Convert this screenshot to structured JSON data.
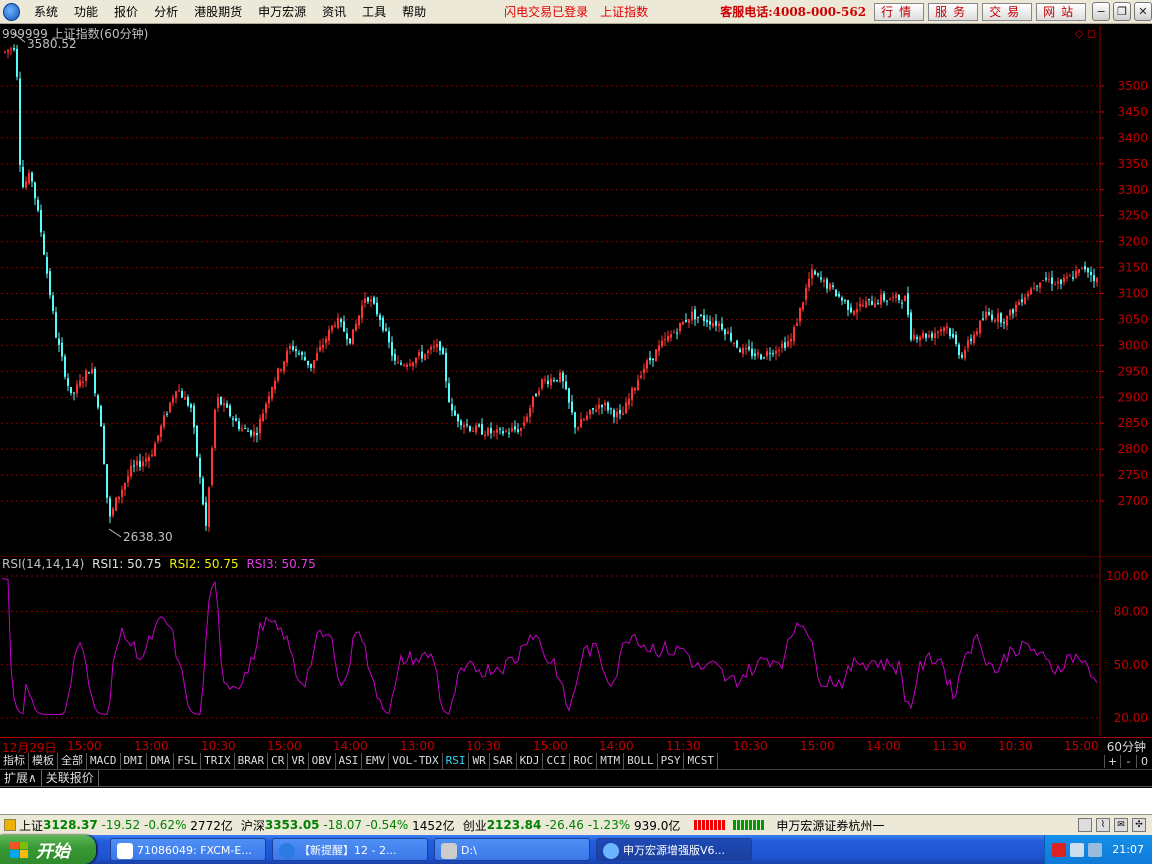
{
  "menu": {
    "items": [
      "系统",
      "功能",
      "报价",
      "分析",
      "港股期货",
      "申万宏源",
      "资讯",
      "工具",
      "帮助"
    ],
    "status": "闪电交易已登录",
    "index_name": "上证指数",
    "hotline": "客服电话:4008-000-562",
    "buttons": [
      "行情",
      "服务",
      "交易",
      "网站"
    ]
  },
  "chart": {
    "title": "999999 上证指数(60分钟)",
    "high_label": "3580.52",
    "low_label": "2638.30",
    "y_ticks": [
      "3500",
      "3450",
      "3400",
      "3350",
      "3300",
      "3250",
      "3200",
      "3150",
      "3100",
      "3050",
      "3000",
      "2950",
      "2900",
      "2850",
      "2800",
      "2750",
      "2700"
    ]
  },
  "indicator": {
    "name": "RSI(14,14,14)",
    "rsi1": "RSI1: 50.75",
    "rsi2": "RSI2: 50.75",
    "rsi3": "RSI3: 50.75",
    "y_ticks": [
      "100.00",
      "80.00",
      "50.00",
      "20.00"
    ]
  },
  "time_axis": {
    "labels": [
      "12月29日",
      "15:00",
      "13:00",
      "10:30",
      "15:00",
      "14:00",
      "13:00",
      "10:30",
      "15:00",
      "14:00",
      "11:30",
      "10:30",
      "15:00",
      "14:00",
      "11:30",
      "10:30",
      "15:00"
    ],
    "period": "60分钟"
  },
  "tabs": [
    "指标",
    "模板",
    "全部",
    "MACD",
    "DMI",
    "DMA",
    "FSL",
    "TRIX",
    "BRAR",
    "CR",
    "VR",
    "OBV",
    "ASI",
    "EMV",
    "VOL-TDX",
    "RSI",
    "WR",
    "SAR",
    "KDJ",
    "CCI",
    "ROC",
    "MTM",
    "BOLL",
    "PSY",
    "MCST"
  ],
  "tab_controls": [
    "+",
    "-",
    "0"
  ],
  "ext_tabs": [
    "扩展∧",
    "关联报价"
  ],
  "status_bar": {
    "sh_name": "上证",
    "sh_value": "3128.37",
    "sh_change": "-19.52",
    "sh_pct": "-0.62%",
    "sh_amt": "2772亿",
    "hs_name": "沪深",
    "hs_value": "3353.05",
    "hs_change": "-18.07",
    "hs_pct": "-0.54%",
    "hs_amt": "1452亿",
    "cy_name": "创业",
    "cy_value": "2123.84",
    "cy_change": "-26.46",
    "cy_pct": "-1.23%",
    "cy_amt": "939.0亿",
    "broker": "申万宏源证券杭州一"
  },
  "taskbar": {
    "start": "开始",
    "tasks": [
      "71086049: FXCM-E...",
      "【新提醒】12 - 2...",
      "D:\\",
      "申万宏源增强版V6..."
    ],
    "clock": "21:07"
  },
  "colors": {
    "up": "#ff3232",
    "down": "#54fcfc",
    "rsi": "#c800c8",
    "grid": "#8b0000"
  }
}
